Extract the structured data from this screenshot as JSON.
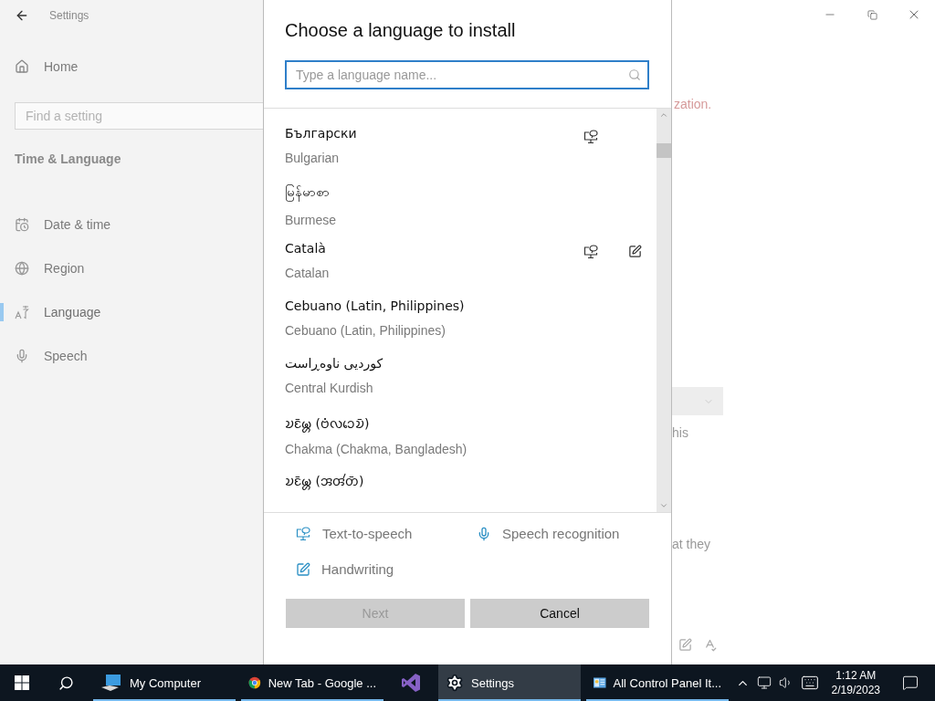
{
  "window": {
    "title": "Settings"
  },
  "sidebar": {
    "home": "Home",
    "search": {
      "placeholder": "Find a setting"
    },
    "section": "Time & Language",
    "items": [
      {
        "label": "Date & time",
        "selected": false
      },
      {
        "label": "Region",
        "selected": false
      },
      {
        "label": "Language",
        "selected": true
      },
      {
        "label": "Speech",
        "selected": false
      }
    ]
  },
  "dialog": {
    "title": "Choose a language to install",
    "search": {
      "placeholder": "Type a language name..."
    },
    "languages": [
      {
        "native": "Български",
        "english": "Bulgarian",
        "text_to_speech": true,
        "handwriting": false
      },
      {
        "native": "မြန်မာစာ",
        "english": "Burmese",
        "text_to_speech": false,
        "handwriting": false
      },
      {
        "native": "Català",
        "english": "Catalan",
        "text_to_speech": true,
        "handwriting": true
      },
      {
        "native": "Cebuano (Latin, Philippines)",
        "english": "Cebuano (Latin, Philippines)",
        "text_to_speech": false,
        "handwriting": false
      },
      {
        "native": "کوردیی ناوەڕاست",
        "english": "Central Kurdish",
        "text_to_speech": false,
        "handwriting": false
      },
      {
        "native": "𑄌𑄋𑄴𑄟𑄳𑄦 (𑄝𑄁𑄣𑄘𑄬𑄌𑄴)",
        "english": "Chakma (Chakma, Bangladesh)",
        "text_to_speech": false,
        "handwriting": false
      },
      {
        "native": "𑄌𑄋𑄴𑄟𑄳𑄦 (𑄞𑄢𑄧𑄖𑄴)",
        "text_to_speech": false,
        "handwriting": false
      }
    ],
    "legend": [
      {
        "kind": "tts",
        "label": "Text-to-speech"
      },
      {
        "kind": "speech",
        "label": "Speech recognition"
      },
      {
        "kind": "handwriting",
        "label": "Handwriting"
      }
    ],
    "buttons": [
      {
        "label": "Next",
        "disabled": true
      },
      {
        "label": "Cancel",
        "disabled": false
      }
    ]
  },
  "background_page": {
    "notice_fragment": "zation.",
    "text_fragments": [
      "his",
      "at they"
    ]
  },
  "taskbar": {
    "apps": [
      {
        "label": "My Computer",
        "running": true,
        "selected": false
      },
      {
        "label": "New Tab - Google ...",
        "running": true,
        "selected": false
      },
      {
        "running": false,
        "selected": false
      },
      {
        "label": "Settings",
        "running": true,
        "selected": true
      },
      {
        "label": "All Control Panel It...",
        "running": true,
        "selected": false
      }
    ],
    "clock": {
      "time": "1:12 AM",
      "date": "2/19/2023"
    }
  }
}
